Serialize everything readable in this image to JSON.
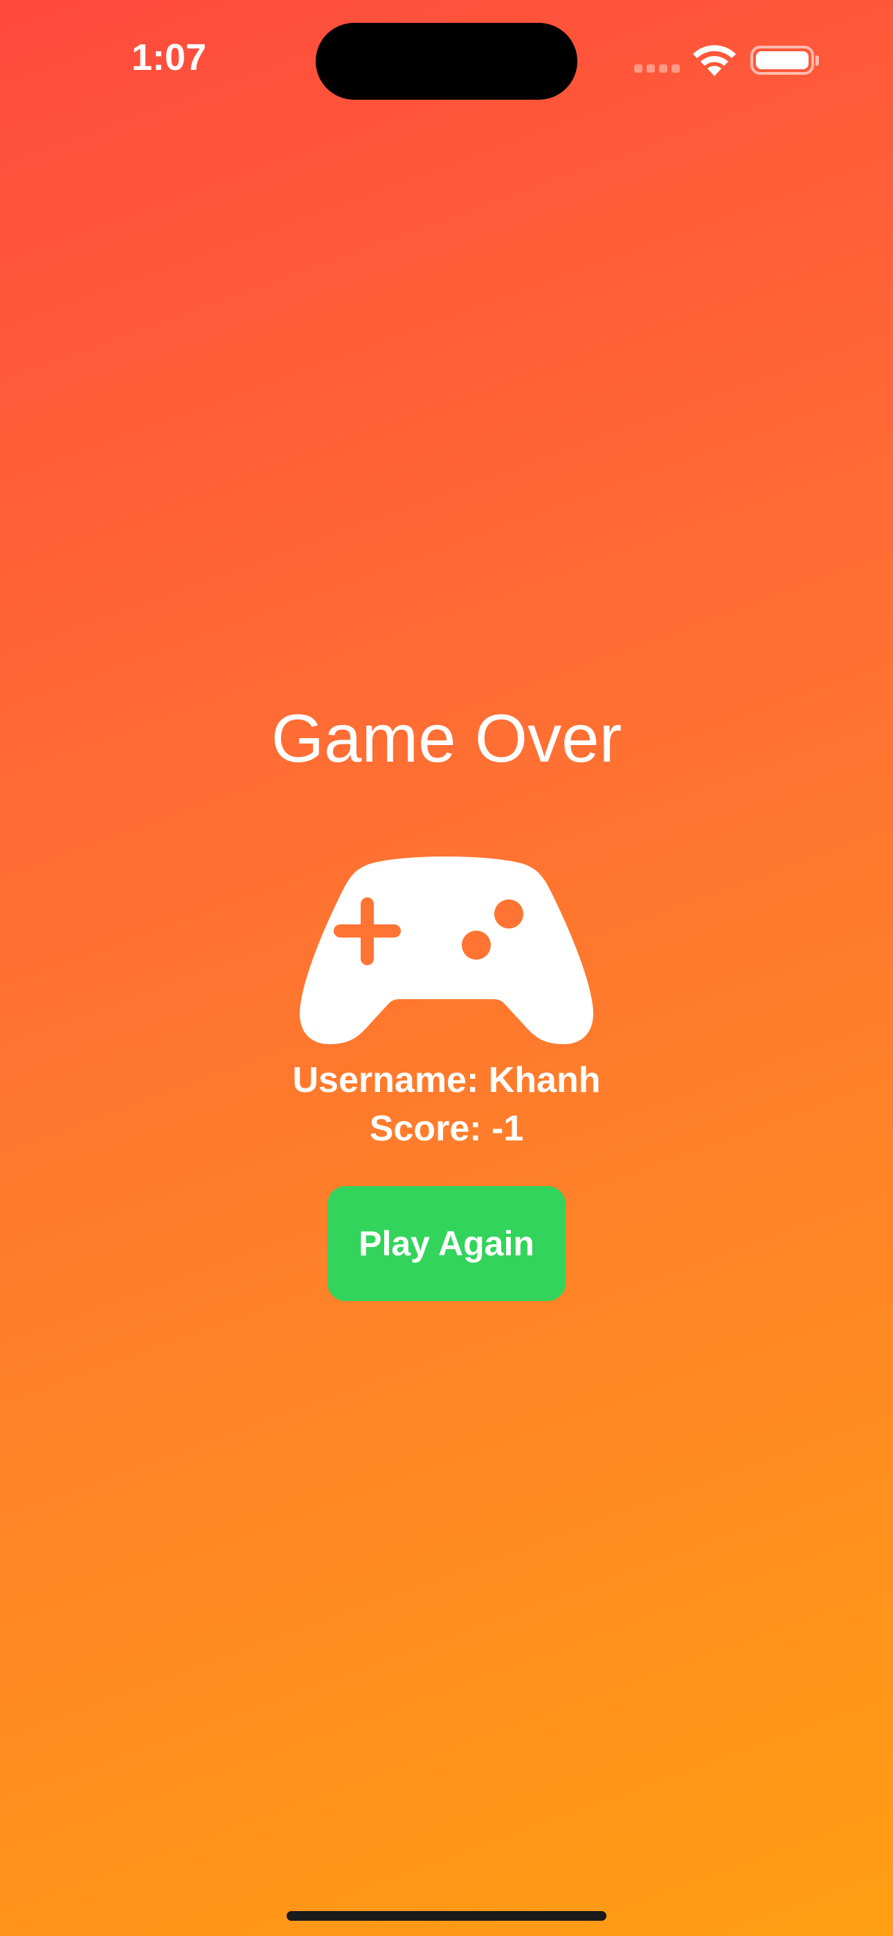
{
  "status_bar": {
    "time": "1:07",
    "icons": [
      "signal-icon",
      "wifi-icon",
      "battery-icon"
    ]
  },
  "game_over": {
    "title": "Game Over",
    "icon": "gamecontroller-icon",
    "username_text": "Username: Khanh",
    "score_text": "Score: -1",
    "play_again_label": "Play Again"
  },
  "colors": {
    "background_top": "#ff4a3d",
    "background_bottom": "#ff9f12",
    "button": "#32d45b",
    "text": "#ffffff"
  }
}
